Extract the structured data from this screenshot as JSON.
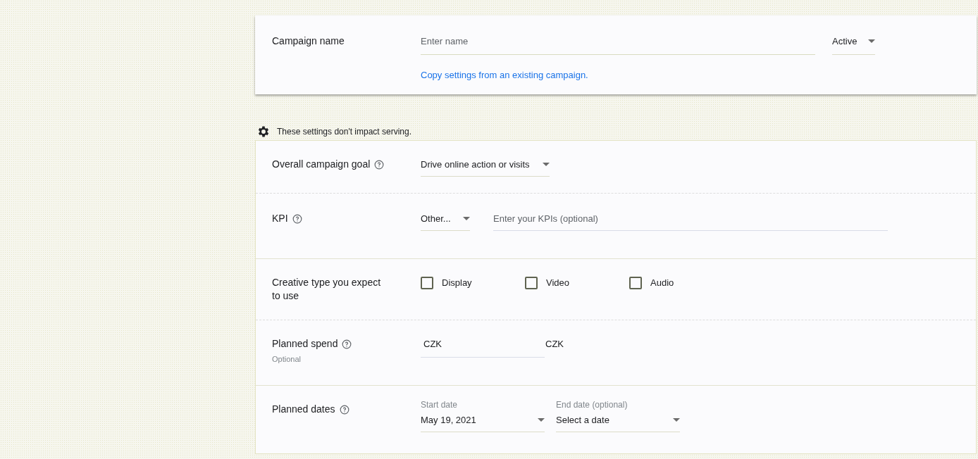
{
  "campaign": {
    "label": "Campaign name",
    "name_field": {
      "placeholder": "Enter name"
    },
    "status": "Active",
    "copy_link": "Copy settings from an existing campaign."
  },
  "notice": "These settings don't impact serving.",
  "rows": [
    {
      "kind": "dropdown",
      "label": "Overall campaign goal",
      "help": true,
      "dropdown": "Drive online action or visits"
    },
    {
      "kind": "kpi",
      "label": "KPI",
      "help": true,
      "dropdown": "Other...",
      "field": {
        "placeholder": "Enter your KPIs (optional)"
      }
    },
    {
      "kind": "checkboxes",
      "label": "Creative type you expect to use",
      "help": false,
      "options": [
        {
          "label": "Display",
          "checked": false
        },
        {
          "label": "Video",
          "checked": false
        },
        {
          "label": "Audio",
          "checked": false
        }
      ]
    },
    {
      "kind": "spend",
      "label": "Planned spend",
      "help": true,
      "sublabel": "Optional",
      "field": {
        "value": "CZK"
      },
      "unit": "CZK"
    },
    {
      "kind": "dates",
      "label": "Planned dates",
      "help": true,
      "dates": [
        {
          "label": "Start date",
          "value": "May 19, 2021"
        },
        {
          "label": "End date (optional)",
          "value": "Select a date"
        }
      ]
    }
  ]
}
